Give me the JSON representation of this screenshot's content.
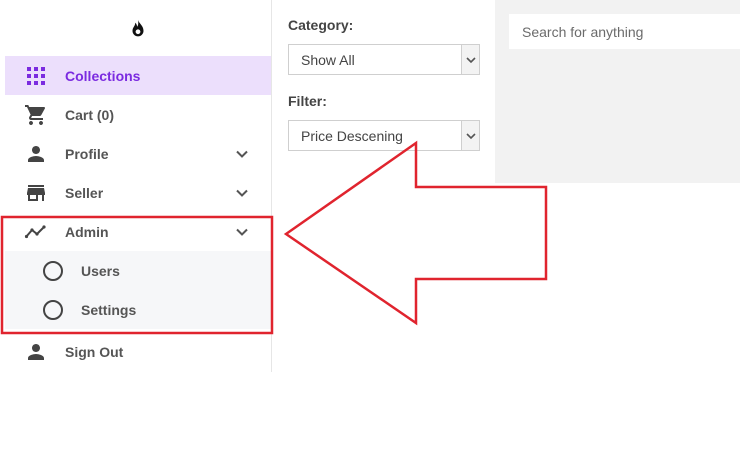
{
  "sidebar": {
    "items": [
      {
        "label": "Collections",
        "icon": "grid-icon"
      },
      {
        "label": "Cart (0)",
        "icon": "cart-icon"
      },
      {
        "label": "Profile",
        "icon": "person-icon"
      },
      {
        "label": "Seller",
        "icon": "store-icon"
      },
      {
        "label": "Admin",
        "icon": "trending-icon"
      },
      {
        "label": "Sign Out",
        "icon": "person-icon"
      }
    ],
    "admin_submenu": [
      {
        "label": "Users",
        "icon": "circle-outline-icon"
      },
      {
        "label": "Settings",
        "icon": "circle-outline-icon"
      }
    ]
  },
  "filters": {
    "category_label": "Category:",
    "category_value": "Show All",
    "filter_label": "Filter:",
    "filter_value": "Price Descening"
  },
  "search": {
    "placeholder": "Search for anything"
  },
  "colors": {
    "accent": "#7b2be0",
    "active_bg": "#ecdffc",
    "annotation": "#e0242e"
  }
}
